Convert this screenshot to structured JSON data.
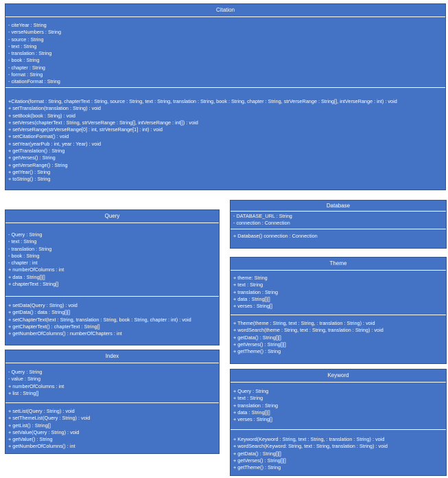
{
  "colors": {
    "box_fill": "#4472c4",
    "box_border": "#2f528f",
    "text": "#ffffff",
    "background": "#ffffff"
  },
  "classes": {
    "citation": {
      "name": "Citation",
      "attributes": [
        "- citeYear : String",
        "- verseNumbers : String",
        "- source : String",
        "- text : String",
        "- translation : String",
        "- book : String",
        "- chapter : String",
        "- format : String",
        "- citationFormat : String"
      ],
      "operations": [
        "+Citation(format : String, chapterText : String, source : String, text : String, translation : String, book : String, chapter : String, strVerseRange : String[], intVerseRange : int) : void",
        "+ setTranslation(translation : String) : void",
        "+ setBook(book : String) : void",
        "+ setVerses(chapterText : String, strVerseRange : String[], intVerseRange : int[]) : void",
        "+ setVerseRange(strVerseRange[0] : int, strVerseRange[1] : int) : void",
        "+ setCitationFormat() : void",
        "+ setYear(yearPub : int, year : Year) : void",
        "+ getTranslation() : String",
        "+ getVerses() : String",
        "+ getVerseRange() : String",
        "+ getYear() : String",
        "+ toString() : String"
      ]
    },
    "query": {
      "name": "Query",
      "attributes": [
        "- Query : String",
        "- text : String",
        "- translation : String",
        "- book : String",
        "- chapter : int",
        "+ numberOfColumns : int",
        "+ data : String[][]",
        "+ chapterText : String[]"
      ],
      "operations": [
        "+ setData(Query : String) : void",
        "+ getData() : data : String[][]",
        "+ setChapterText(text : String, translation : String, book : String, chapter : int) : void",
        "+ getChapterText() : chapterText : String[]",
        "+ getNumberOfColumns() : numberOfChapters : int"
      ]
    },
    "index": {
      "name": "Index",
      "attributes": [
        "- Query : String",
        "- value : String",
        "+ numberOfColumns : int",
        "+ list : String[]"
      ],
      "operations": [
        "+ setList(Query : String) : void",
        "+ setThemeList(Query : String) : void",
        "+ getList() : String[]",
        "+ setValue(Query : String) : void",
        "+ getValue() : String",
        "+ getNumberOfColumns() : int"
      ]
    },
    "database": {
      "name": "Database",
      "attributes": [
        "- DATABASE_URL : String",
        "- connection : Connection"
      ],
      "operations": [
        "+ Database() connection : Connection"
      ]
    },
    "theme": {
      "name": "Theme",
      "attributes": [
        "+ theme: String",
        "+ text : String",
        "+ translation : String",
        "+ data : String[][]",
        "+ verses : String[]"
      ],
      "operations": [
        "+ Theme(theme : String, text : String, : translation : String) : void",
        "+ wordSearch(theme : String, text : String, translation : String) : void",
        "+ getData() : String[][]",
        "+ getVerses() : String[][]",
        "+ getTheme() : String"
      ]
    },
    "keyword": {
      "name": "Keyword",
      "attributes": [
        "+ Query : String",
        "+ text : String",
        "+ translation : String",
        "+ data : String[][]",
        "+ verses : String[]"
      ],
      "operations": [
        "+ Keyword(Keyword : String, text : String, : translation : String) : void",
        "+ wordSearch(Keyword: String, text : String, translation : String) : void",
        "+ getData() : String[][]",
        "+ getVerses() : String[][]",
        "+ getTheme() : String"
      ]
    }
  }
}
